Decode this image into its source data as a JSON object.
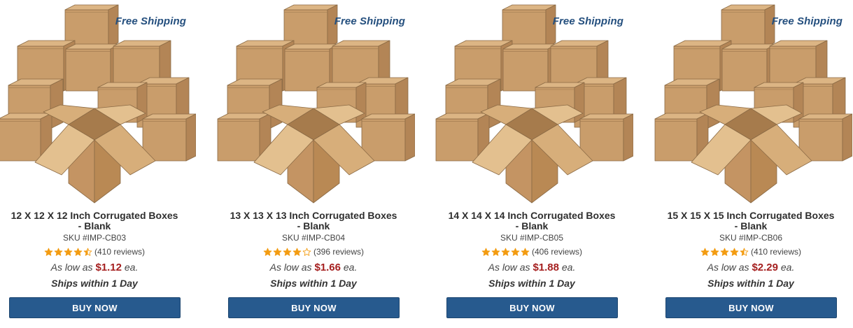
{
  "colors": {
    "brand_blue": "#275a8e",
    "free_shipping": "#244f7e",
    "price_red": "#a51f1f",
    "star_orange": "#f39c12",
    "cardboard": "#c49a6c"
  },
  "products": [
    {
      "badge": "Free Shipping",
      "title_line1": "12 X 12 X 12 Inch Corrugated Boxes",
      "title_line2": "- Blank",
      "sku": "SKU #IMP-CB03",
      "rating": 4.5,
      "reviews": "(410 reviews)",
      "price_prefix": "As low as",
      "price": "$1.12",
      "price_suffix": "ea.",
      "ships": "Ships within 1 Day",
      "button": "BUY NOW"
    },
    {
      "badge": "Free Shipping",
      "title_line1": "13 X 13 X 13 Inch Corrugated Boxes",
      "title_line2": "- Blank",
      "sku": "SKU #IMP-CB04",
      "rating": 4.0,
      "reviews": "(396 reviews)",
      "price_prefix": "As low as",
      "price": "$1.66",
      "price_suffix": "ea.",
      "ships": "Ships within 1 Day",
      "button": "BUY NOW"
    },
    {
      "badge": "Free Shipping",
      "title_line1": "14 X 14 X 14 Inch Corrugated Boxes",
      "title_line2": "- Blank",
      "sku": "SKU #IMP-CB05",
      "rating": 5.0,
      "reviews": "(406 reviews)",
      "price_prefix": "As low as",
      "price": "$1.88",
      "price_suffix": "ea.",
      "ships": "Ships within 1 Day",
      "button": "BUY NOW"
    },
    {
      "badge": "Free Shipping",
      "title_line1": "15 X 15 X 15 Inch Corrugated Boxes",
      "title_line2": "- Blank",
      "sku": "SKU #IMP-CB06",
      "rating": 4.5,
      "reviews": "(410 reviews)",
      "price_prefix": "As low as",
      "price": "$2.29",
      "price_suffix": "ea.",
      "ships": "Ships within 1 Day",
      "button": "BUY NOW"
    }
  ]
}
